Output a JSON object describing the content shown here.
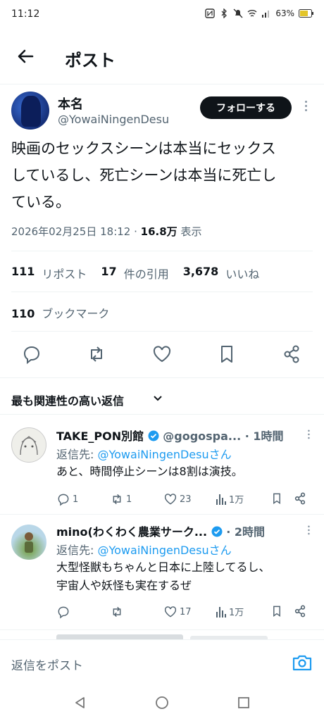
{
  "status": {
    "time": "11:12",
    "battery": "63%"
  },
  "header": {
    "title": "ポスト"
  },
  "post": {
    "author_name": "本名",
    "author_handle": "@YowaiNingenDesu",
    "follow_label": "フォローする",
    "text_line1": "映画のセックスシーンは本当にセックス",
    "text_line2": "しているし、死亡シーンは本当に死亡し",
    "text_line3": "ている。",
    "date": "2026年02月25日 18:12 · ",
    "views_count": "16.8万",
    "views_label": " 表示",
    "reposts_count": "111",
    "reposts_label": "リポスト",
    "quotes_count": "17",
    "quotes_label": "件の引用",
    "likes_count": "3,678",
    "likes_label": "いいね",
    "bookmarks_count": "110",
    "bookmarks_label": "ブックマーク"
  },
  "sort": {
    "label": "最も関連性の高い返信"
  },
  "replies": [
    {
      "name": "TAKE_PON別館",
      "handle": "@gogospa...",
      "time": "· 1時間",
      "reply_to_prefix": "返信先: ",
      "reply_to": "@YowaiNingenDesuさん",
      "text1": "あと、時間停止シーンは8割は演技。",
      "text2": "",
      "replies": "1",
      "reposts": "1",
      "likes": "23",
      "views": "1万"
    },
    {
      "name": "mino(わくわく農業サーク...",
      "handle": "",
      "time": "· 2時間",
      "reply_to_prefix": "返信先: ",
      "reply_to": "@YowaiNingenDesuさん",
      "text1": "大型怪獣もちゃんと日本に上陸してるし、",
      "text2": "宇宙人や妖怪も実在するぜ",
      "replies": "",
      "reposts": "",
      "likes": "17",
      "views": "1万"
    }
  ],
  "composer": {
    "placeholder": "返信をポスト"
  },
  "colors": {
    "accent": "#1d9bf0",
    "text": "#0f1419",
    "muted": "#536471"
  }
}
